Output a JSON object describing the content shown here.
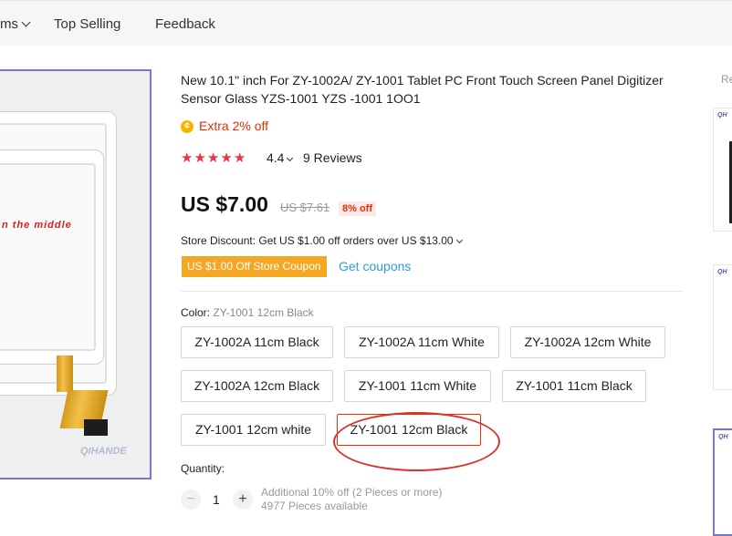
{
  "nav": {
    "items_label": "ms",
    "top_selling": "Top Selling",
    "feedback": "Feedback"
  },
  "gallery": {
    "overlay_text": "n the middle",
    "watermark": "QIHANDE"
  },
  "product": {
    "title": "New 10.1\" inch For ZY-1002A/ ZY-1001 Tablet PC Front Touch Screen Panel Digitizer Sensor Glass YZS-1001 YZS -1001 1OO1",
    "extra_off": "Extra 2% off",
    "rating": "4.4",
    "reviews": "9 Reviews",
    "price": "US $7.00",
    "original_price": "US $7.61",
    "discount": "8% off"
  },
  "store": {
    "discount_text": "Store Discount: Get US $1.00 off orders over US $13.00",
    "coupon_label": "US $1.00 Off Store Coupon",
    "get_coupons": "Get coupons"
  },
  "color": {
    "label": "Color:",
    "selected": "ZY-1001 12cm Black",
    "options": [
      "ZY-1002A 11cm Black",
      "ZY-1002A 11cm White",
      "ZY-1002A 12cm White",
      "ZY-1002A 12cm Black",
      "ZY-1001 11cm White",
      "ZY-1001 11cm Black",
      "ZY-1001 12cm white",
      "ZY-1001 12cm Black"
    ]
  },
  "quantity": {
    "label": "Quantity:",
    "minus": "−",
    "value": "1",
    "plus": "+",
    "note_line1": "Additional 10% off (2 Pieces or more)",
    "note_line2": "4977 Pieces available"
  },
  "sidebar": {
    "title": "Re"
  },
  "colors": {
    "accent_red": "#e62e04",
    "star": "#e8334b",
    "coupon": "#f5a623",
    "link": "#2d9cdb",
    "annotation_circle": "#d8342c"
  }
}
